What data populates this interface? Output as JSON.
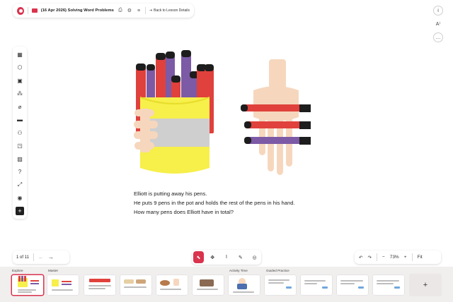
{
  "header": {
    "title": "(16 Apr 2026) Solving Word Problems",
    "back_label": "Back to Lesson Details"
  },
  "question": {
    "line1": "Elliott is putting away his pens.",
    "line2": "He puts 9 pens in the pot and holds the rest of the pens in his hand.",
    "line3": "How many pens does Elliott have in total?"
  },
  "pager": {
    "label": "1 of 11"
  },
  "zoom": {
    "value": "73%",
    "fit_label": "Fit"
  },
  "slide_strip": {
    "sections": [
      "Explore",
      "Master",
      "Activity Time",
      "Guided Practice"
    ],
    "add_symbol": "+"
  },
  "colors": {
    "accent": "#d9334d",
    "pen_red": "#e0413c",
    "pen_purple": "#7c5aa6",
    "pot_yellow": "#f7ef4a",
    "pot_band": "#cfcfcf",
    "skin": "#f6d7bd"
  },
  "icons": {
    "left_toolbar": [
      "layout-icon",
      "cube-icon",
      "image-frame-icon",
      "shapes-icon",
      "attachment-icon",
      "ruler-icon",
      "users-icon",
      "sticky-note-icon",
      "picture-icon",
      "question-box-icon",
      "resize-icon",
      "stamp-icon",
      "add-icon"
    ]
  }
}
